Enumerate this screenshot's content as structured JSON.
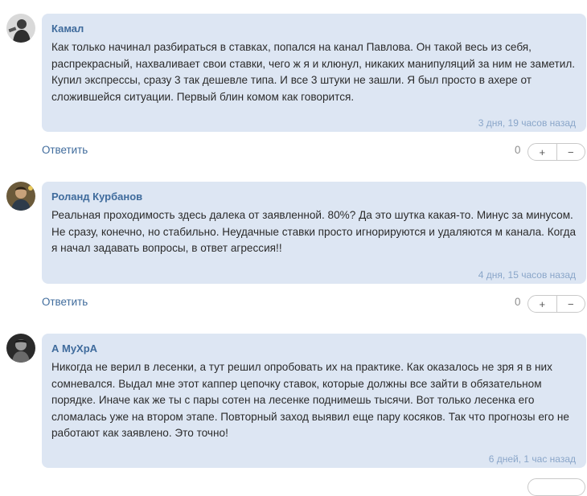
{
  "comments": [
    {
      "author": "Камал",
      "text": "Как только начинал разбираться в ставках, попался на канал Павлова. Он такой весь из себя, распрекрасный, нахваливает свои ставки, чего ж я и клюнул, никаких манипуляций за ним не заметил. Купил экспрессы, сразу 3 так дешевле типа. И все 3 штуки не зашли. Я был просто в ахере от сложившейся ситуации. Первый блин комом как говорится.",
      "time": "3 дня, 19 часов назад",
      "reply_label": "Ответить",
      "score": "0",
      "upvote_label": "+",
      "downvote_label": "−"
    },
    {
      "author": "Роланд Курбанов",
      "text": "Реальная проходимость здесь далека от заявленной. 80%? Да это шутка какая-то. Минус за минусом. Не сразу, конечно, но стабильно. Неудачные ставки просто игнорируются и удаляются м канала. Когда я начал задавать вопросы, в ответ агрессия!!",
      "time": "4 дня, 15 часов назад",
      "reply_label": "Ответить",
      "score": "0",
      "upvote_label": "+",
      "downvote_label": "−"
    },
    {
      "author": "А МуХрА",
      "text": "Никогда не верил в лесенки, а тут решил опробовать их на практике. Как оказалось не зря я в них сомневался. Выдал мне этот каппер цепочку ставок, которые должны все зайти в обязательном порядке. Иначе как же ты с пары сотен на лесенке поднимешь тысячи. Вот только лесенка его сломалась уже на втором этапе. Повторный заход выявил еще пару косяков. Так что прогнозы его не работают как заявлено. Это точно!",
      "time": "6 дней, 1 час назад"
    }
  ]
}
